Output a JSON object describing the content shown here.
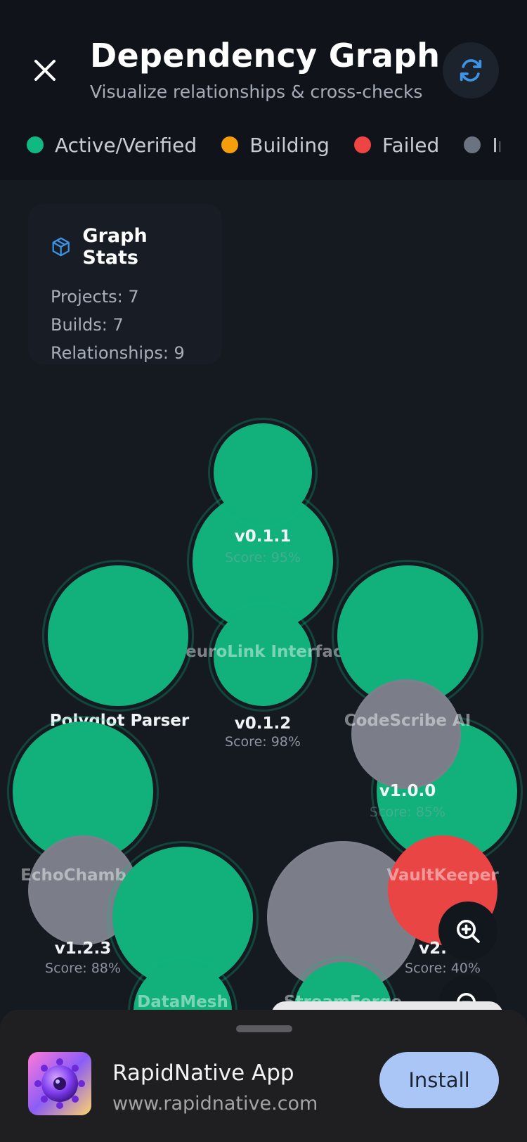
{
  "header": {
    "title": "Dependency Graph",
    "subtitle": "Visualize relationships & cross-checks",
    "close_icon": "close-icon",
    "refresh_icon": "refresh-icon"
  },
  "legend": [
    {
      "label": "Active/Verified",
      "color": "#10b981"
    },
    {
      "label": "Building",
      "color": "#f59e0b"
    },
    {
      "label": "Failed",
      "color": "#ef4444"
    },
    {
      "label": "Ina",
      "color": "#6b7280"
    }
  ],
  "stats": {
    "icon": "cube-icon",
    "title": "Graph Stats",
    "projects": "Projects: 7",
    "builds": "Builds: 7",
    "relationships": "Relationships: 9"
  },
  "graph": {
    "nodes": {
      "neurolink": {
        "label": "NeuroLink Interface",
        "status": "active"
      },
      "v011": {
        "label": "v0.1.1",
        "score": "Score: 95%",
        "status": "active"
      },
      "v012": {
        "label": "v0.1.2",
        "score": "Score: 98%",
        "status": "active"
      },
      "polyglot": {
        "label": "Polyglot Parser",
        "status": "active"
      },
      "codescribe": {
        "label": "CodeScribe AI",
        "status": "active"
      },
      "v100": {
        "label": "v1.0.0",
        "score": "Score: 85%",
        "status": "active"
      },
      "echochamber": {
        "label": "EchoChamber",
        "status": "inactive"
      },
      "v123": {
        "label": "v1.2.3",
        "score": "Score: 88%",
        "status": "active"
      },
      "vaultkeeper": {
        "label": "VaultKeeper",
        "status": "failed"
      },
      "v2x": {
        "label": "v2.",
        "score": "Score: 40%",
        "status": "failed"
      },
      "datamesh": {
        "label": "DataMesh",
        "status": "active"
      },
      "streamforge": {
        "label": "StreamForge",
        "status": "active"
      }
    }
  },
  "controls": {
    "zoom_in_icon": "zoom-in-icon",
    "zoom_out_icon": "zoom-out-icon"
  },
  "banner": {
    "app_name": "RapidNative App",
    "url": "www.rapidnative.com",
    "install_label": "Install"
  }
}
